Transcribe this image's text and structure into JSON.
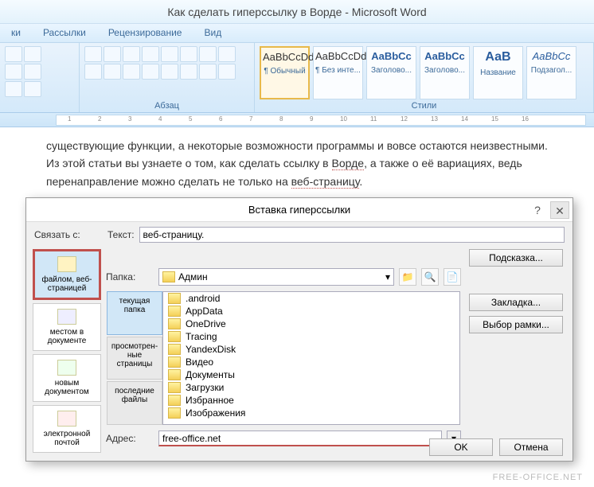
{
  "title": "Как сделать гиперссылку в Ворде - Microsoft Word",
  "tabs": [
    "ки",
    "Рассылки",
    "Рецензирование",
    "Вид"
  ],
  "ribbon": {
    "paragraph_label": "Абзац",
    "styles_label": "Стили",
    "styles": [
      {
        "preview": "AaBbCcDd",
        "name": "¶ Обычный"
      },
      {
        "preview": "AaBbCcDd",
        "name": "¶ Без инте..."
      },
      {
        "preview": "AaBbCc",
        "name": "Заголово..."
      },
      {
        "preview": "AaBbCc",
        "name": "Заголово..."
      },
      {
        "preview": "АаВ",
        "name": "Название"
      },
      {
        "preview": "AaBbCc",
        "name": "Подзагол..."
      }
    ]
  },
  "ruler_ticks": [
    "1",
    "2",
    "3",
    "4",
    "5",
    "6",
    "7",
    "8",
    "9",
    "10",
    "11",
    "12",
    "13",
    "14",
    "15",
    "16"
  ],
  "document": {
    "line1_a": "существующие функции, а некоторые возможности программы и вовсе остаются неизвестными.",
    "line2_a": "Из этой статьи вы узнаете о том, как сделать ссылку в ",
    "line2_b": "Ворде",
    "line2_c": ", а также о её вариациях, ведь",
    "line3_a": "перенаправление можно сделать не только на ",
    "line3_b": "веб-страницу",
    "line3_c": "."
  },
  "dialog": {
    "title": "Вставка гиперссылки",
    "link_with": "Связать с:",
    "text_label": "Текст:",
    "text_value": "веб-страницу.",
    "hint_btn": "Подсказка...",
    "folder_label": "Папка:",
    "folder_value": "Админ",
    "browse_tabs": [
      "текущая папка",
      "просмотрен-ные страницы",
      "последние файлы"
    ],
    "files": [
      ".android",
      "AppData",
      "OneDrive",
      "Tracing",
      "YandexDisk",
      "Видео",
      "Документы",
      "Загрузки",
      "Избранное",
      "Изображения"
    ],
    "addr_label": "Адрес:",
    "addr_value": "free-office.net",
    "bookmark_btn": "Закладка...",
    "frame_btn": "Выбор рамки...",
    "ok": "OK",
    "cancel": "Отмена",
    "linkto": [
      {
        "label": "файлом, веб-страницей"
      },
      {
        "label": "местом в документе"
      },
      {
        "label": "новым документом"
      },
      {
        "label": "электронной почтой"
      }
    ]
  },
  "watermark": "FREE-OFFICE.NET"
}
